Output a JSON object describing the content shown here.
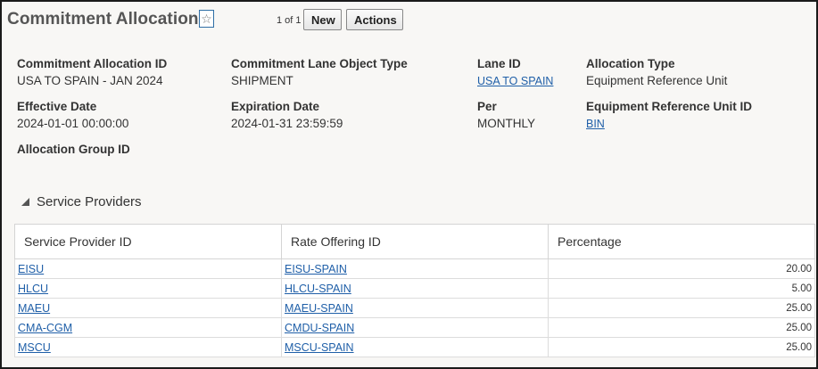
{
  "header": {
    "title": "Commitment Allocation",
    "pager": "1 of 1",
    "new_label": "New",
    "actions_label": "Actions",
    "favorite_icon": "☆"
  },
  "details": {
    "commitment_allocation_id": {
      "label": "Commitment Allocation ID",
      "value": "USA TO SPAIN - JAN 2024"
    },
    "commitment_lane_object_type": {
      "label": "Commitment Lane Object Type",
      "value": "SHIPMENT"
    },
    "lane_id": {
      "label": "Lane ID",
      "value": "USA TO SPAIN"
    },
    "allocation_type": {
      "label": "Allocation Type",
      "value": "Equipment Reference Unit"
    },
    "effective_date": {
      "label": "Effective Date",
      "value": "2024-01-01 00:00:00"
    },
    "expiration_date": {
      "label": "Expiration Date",
      "value": "2024-01-31 23:59:59"
    },
    "per": {
      "label": "Per",
      "value": "MONTHLY"
    },
    "equipment_reference_unit_id": {
      "label": "Equipment Reference Unit ID",
      "value": "BIN"
    },
    "allocation_group_id": {
      "label": "Allocation Group ID",
      "value": ""
    }
  },
  "service_providers": {
    "title": "Service Providers",
    "columns": [
      "Service Provider ID",
      "Rate Offering ID",
      "Percentage"
    ],
    "rows": [
      {
        "provider": "EISU",
        "rate_offering": "EISU-SPAIN",
        "percentage": "20.00"
      },
      {
        "provider": "HLCU",
        "rate_offering": "HLCU-SPAIN",
        "percentage": "5.00"
      },
      {
        "provider": "MAEU",
        "rate_offering": "MAEU-SPAIN",
        "percentage": "25.00"
      },
      {
        "provider": "CMA-CGM",
        "rate_offering": "CMDU-SPAIN",
        "percentage": "25.00"
      },
      {
        "provider": "MSCU",
        "rate_offering": "MSCU-SPAIN",
        "percentage": "25.00"
      }
    ]
  },
  "colors": {
    "link": "#1f5fa8",
    "panel_background": "#f8f7f5",
    "frame_border": "#1a1a1a"
  }
}
